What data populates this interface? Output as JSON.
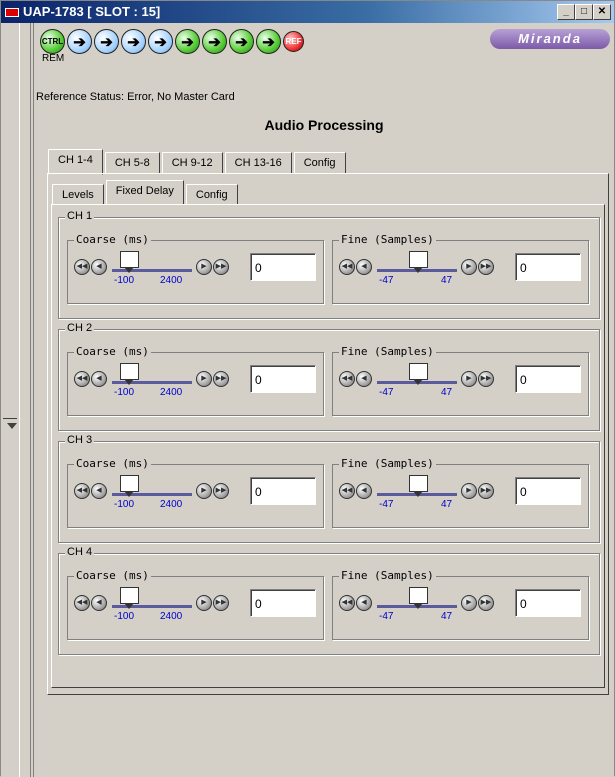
{
  "window": {
    "title": "UAP-1783 [ SLOT : 15]"
  },
  "header": {
    "icons": [
      "CTRL",
      "arrow",
      "arrow",
      "arrow",
      "arrow",
      "arrow",
      "arrow",
      "arrow",
      "arrow",
      "REF"
    ],
    "ctrl_label": "CTRL",
    "ref_label": "REF",
    "rem_label": "REM",
    "brand": "Miranda"
  },
  "status": {
    "reference": "Reference Status: Error, No Master Card"
  },
  "panel": {
    "title": "Audio Processing"
  },
  "tabs": [
    "CH 1-4",
    "CH 5-8",
    "CH 9-12",
    "CH 13-16",
    "Config"
  ],
  "subtabs": [
    "Levels",
    "Fixed Delay",
    "Config"
  ],
  "channels": [
    {
      "label": "CH 1",
      "coarse_label": "Coarse (ms)",
      "coarse_min": "-100",
      "coarse_max": "2400",
      "coarse_value": "0",
      "fine_label": "Fine (Samples)",
      "fine_min": "-47",
      "fine_max": "47",
      "fine_value": "0"
    },
    {
      "label": "CH 2",
      "coarse_label": "Coarse (ms)",
      "coarse_min": "-100",
      "coarse_max": "2400",
      "coarse_value": "0",
      "fine_label": "Fine (Samples)",
      "fine_min": "-47",
      "fine_max": "47",
      "fine_value": "0"
    },
    {
      "label": "CH 3",
      "coarse_label": "Coarse (ms)",
      "coarse_min": "-100",
      "coarse_max": "2400",
      "coarse_value": "0",
      "fine_label": "Fine (Samples)",
      "fine_min": "-47",
      "fine_max": "47",
      "fine_value": "0"
    },
    {
      "label": "CH 4",
      "coarse_label": "Coarse (ms)",
      "coarse_min": "-100",
      "coarse_max": "2400",
      "coarse_value": "0",
      "fine_label": "Fine (Samples)",
      "fine_min": "-47",
      "fine_max": "47",
      "fine_value": "0"
    }
  ]
}
